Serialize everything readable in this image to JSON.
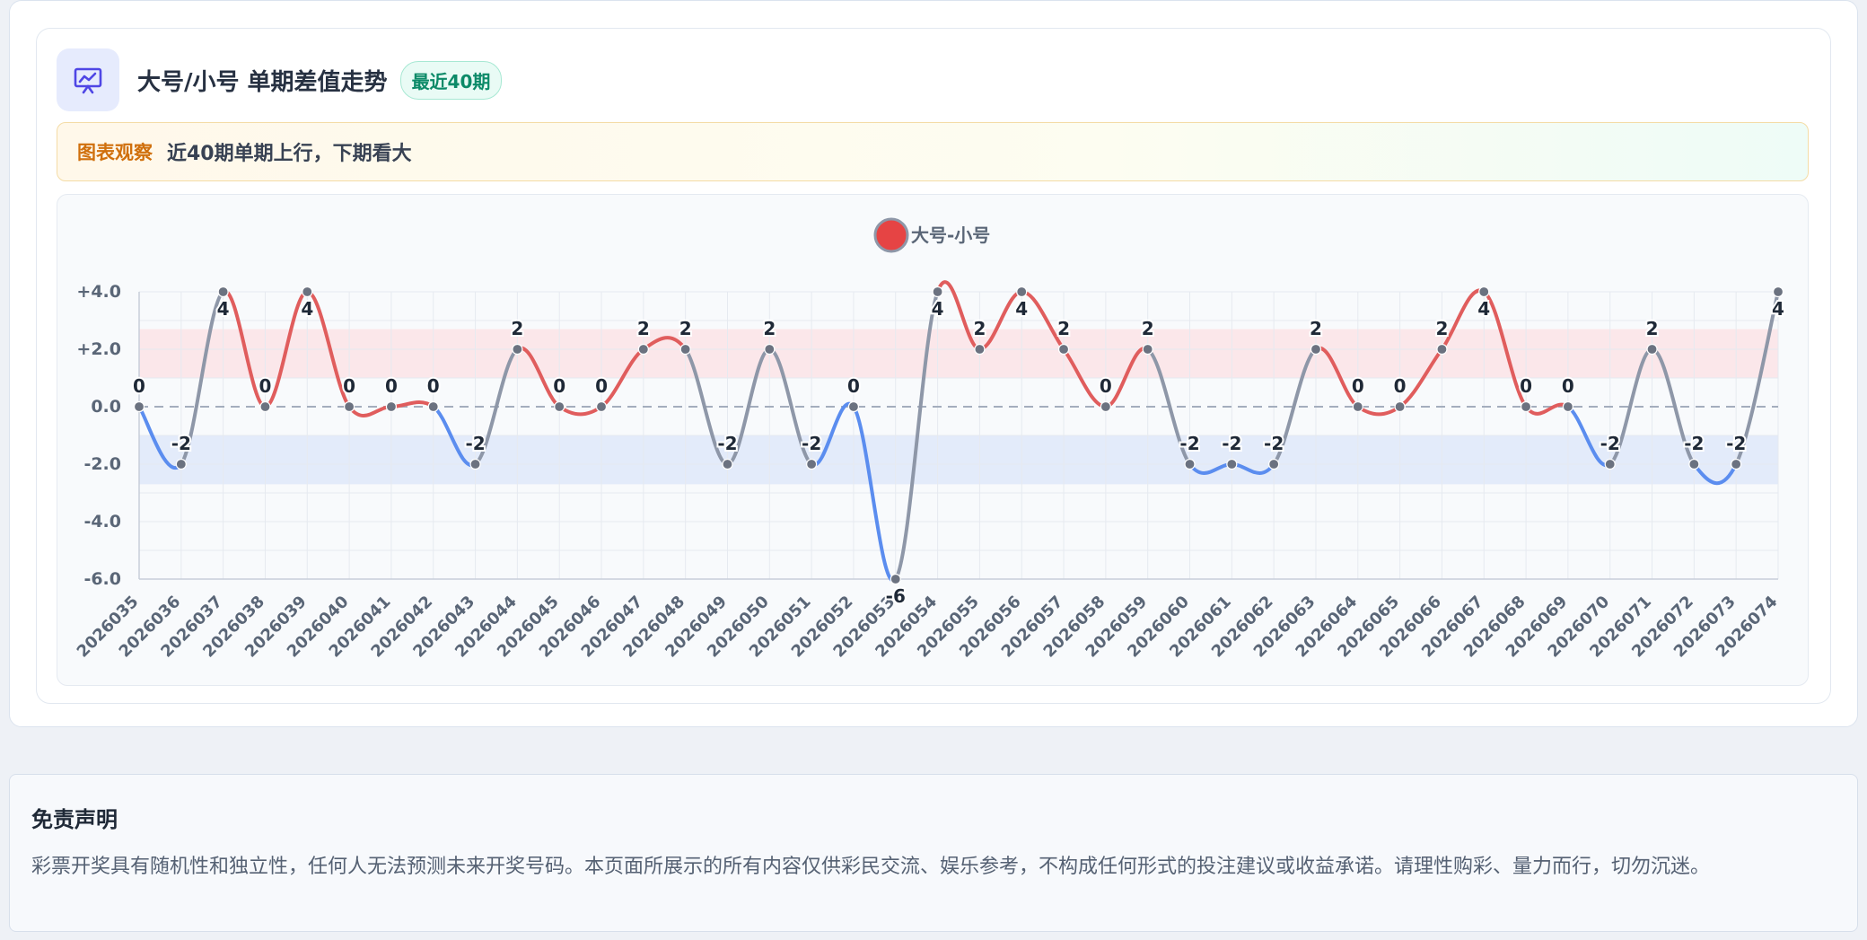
{
  "header": {
    "title": "大号/小号 单期差值走势",
    "badge": "最近40期",
    "icon": "chart-presentation-icon"
  },
  "observation": {
    "label": "图表观察",
    "text": "近40期单期上行，下期看大"
  },
  "colors": {
    "positive": "#e05d5d",
    "negative": "#5b8def",
    "neutral": "#8e97a8",
    "point": "#6b7280",
    "band_positive": "#fbe3e6",
    "band_negative": "#dfe7f9",
    "legend_marker": "#e64444",
    "icon": "#4f46e5"
  },
  "chart_data": {
    "type": "line",
    "title": "",
    "xlabel": "",
    "ylabel": "",
    "legend": [
      "大号-小号"
    ],
    "legend_position": "top-center",
    "ylim": [
      -6,
      4
    ],
    "yticks": [
      "+4.0",
      "+2.0",
      "0.0",
      "-2.0",
      "-4.0",
      "-6.0"
    ],
    "grid": true,
    "bands": [
      [
        1,
        2.7
      ],
      [
        -2.7,
        -1
      ]
    ],
    "categories": [
      "2026035",
      "2026036",
      "2026037",
      "2026038",
      "2026039",
      "2026040",
      "2026041",
      "2026042",
      "2026043",
      "2026044",
      "2026045",
      "2026046",
      "2026047",
      "2026048",
      "2026049",
      "2026050",
      "2026051",
      "2026052",
      "2026053",
      "2026054",
      "2026055",
      "2026056",
      "2026057",
      "2026058",
      "2026059",
      "2026060",
      "2026061",
      "2026062",
      "2026063",
      "2026064",
      "2026065",
      "2026066",
      "2026067",
      "2026068",
      "2026069",
      "2026070",
      "2026071",
      "2026072",
      "2026073",
      "2026074"
    ],
    "series": [
      {
        "name": "大号-小号",
        "values": [
          0,
          -2,
          4,
          0,
          4,
          0,
          0,
          0,
          -2,
          2,
          0,
          0,
          2,
          2,
          -2,
          2,
          -2,
          0,
          -6,
          4,
          2,
          4,
          2,
          0,
          2,
          -2,
          -2,
          -2,
          2,
          0,
          0,
          2,
          4,
          0,
          0,
          -2,
          2,
          -2,
          -2,
          4
        ]
      }
    ]
  },
  "disclaimer": {
    "title": "免责声明",
    "text": "彩票开奖具有随机性和独立性，任何人无法预测未来开奖号码。本页面所展示的所有内容仅供彩民交流、娱乐参考，不构成任何形式的投注建议或收益承诺。请理性购彩、量力而行，切勿沉迷。"
  }
}
